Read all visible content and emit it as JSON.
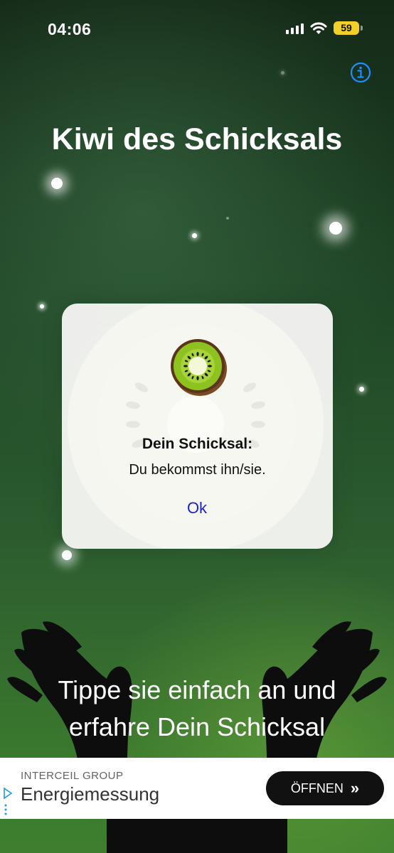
{
  "status_bar": {
    "time": "04:06",
    "battery_level": "59",
    "icons": [
      "cellular-signal-icon",
      "wifi-icon",
      "battery-icon"
    ]
  },
  "header": {
    "title": "Kiwi des Schicksals",
    "info_icon": "info-icon",
    "accent_color": "#1e8cff"
  },
  "tagline": {
    "line1": "Tippe sie einfach an und",
    "line2": "erfahre Dein Schicksal"
  },
  "alert": {
    "icon": "kiwi-icon",
    "title": "Dein Schicksal:",
    "message": "Du bekommst ihn/sie.",
    "ok_label": "Ok",
    "ok_color": "#1a22c8"
  },
  "ad": {
    "advertiser": "INTERCEIL GROUP",
    "headline": "Energiemessung",
    "cta_label": "ÖFFNEN",
    "cta_icon": "double-chevron-right-icon",
    "adchoices_icon": "adchoices-icon"
  }
}
